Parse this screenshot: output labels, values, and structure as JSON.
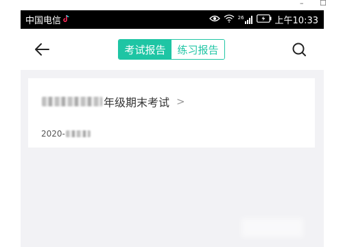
{
  "window": {
    "minimize_glyph": "–",
    "maximize_glyph": "☐"
  },
  "status_bar": {
    "carrier": "中国电信",
    "app_icon": "tiktok-icon",
    "icons": [
      "eye-icon",
      "wifi-icon",
      "signal-icon",
      "battery-icon"
    ],
    "network_label": "26",
    "time": "上午10:33"
  },
  "nav": {
    "back_icon": "arrow-left-icon",
    "tabs": [
      {
        "label": "考试报告",
        "active": true
      },
      {
        "label": "练习报告",
        "active": false
      }
    ],
    "search_icon": "search-icon"
  },
  "report": {
    "title_suffix": "年级期末考试",
    "chevron": ">",
    "date_prefix": "2020-"
  },
  "colors": {
    "accent": "#1ec5a4",
    "background": "#f2f2f5"
  }
}
